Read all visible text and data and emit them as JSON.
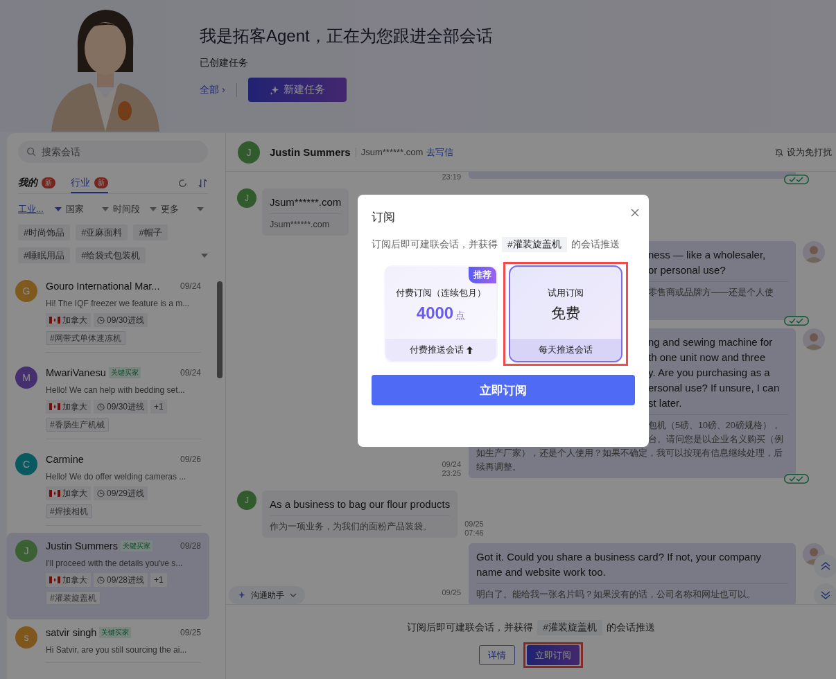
{
  "header": {
    "title": "我是拓客Agent，正在为您跟进全部会话",
    "subtitle": "已创建任务",
    "all_link": "全部 ›",
    "new_task_button": "新建任务"
  },
  "sidebar": {
    "search": {
      "placeholder": "搜索会话"
    },
    "tabs": [
      {
        "label": "我的",
        "badge": "新",
        "selected": false
      },
      {
        "label": "行业",
        "badge": "新",
        "selected": true
      }
    ],
    "filters": [
      {
        "label": "工业...",
        "active": true
      },
      {
        "label": "国家",
        "active": false
      },
      {
        "label": "时间段",
        "active": false
      },
      {
        "label": "更多",
        "active": false
      }
    ],
    "tags": [
      "#时尚饰品",
      "#亚麻面料",
      "#帽子",
      "#睡眠用品",
      "#给袋式包装机"
    ],
    "conversations": [
      {
        "initial": "G",
        "color": "#7f5a1e",
        "name": "Gouro International Mar...",
        "date": "09/24",
        "preview": "Hi! The IQF freezer we feature is a m...",
        "country": "加拿大",
        "followup": "09/30进线",
        "topic": "#网带式单体速冻机",
        "selected": false
      },
      {
        "initial": "M",
        "color": "#46306f",
        "name": "MwariVanesu",
        "badge": "关键买家",
        "date": "09/24",
        "preview": "Hello! We can help with bedding set...",
        "country": "加拿大",
        "followup": "09/30进线",
        "extra": "+1",
        "topic": "#香肠生产机械",
        "selected": false
      },
      {
        "initial": "C",
        "color": "#0a5a60",
        "name": "Carmine",
        "date": "09/26",
        "preview": "Hello! We do offer welding cameras ...",
        "country": "加拿大",
        "followup": "09/29进线",
        "topic": "#焊接相机",
        "selected": false
      },
      {
        "initial": "J",
        "color": "#3b6134",
        "name": "Justin Summers",
        "badge": "关键买家",
        "date": "09/28",
        "preview": "I'll proceed with the details you've s...",
        "country": "加拿大",
        "followup": "09/28进线",
        "extra": "+1",
        "topic": "#灌装旋盖机",
        "selected": true
      },
      {
        "initial": "s",
        "color": "#7f571d",
        "name": "satvir singh",
        "badge": "关键买家",
        "date": "09/25",
        "preview": "Hi Satvir, are you still sourcing the ai...",
        "selected": false
      }
    ]
  },
  "chat": {
    "contact": {
      "initial": "J",
      "name": "Justin Summers",
      "email": "Jsum******.com",
      "write_link": "去写信"
    },
    "mute_button": "设为免打扰",
    "messages": [
      {
        "kind": "stub",
        "time": [
          "23:19"
        ],
        "read": true
      },
      {
        "kind": "incoming",
        "initial": "J",
        "lines": [
          "Jsum******.com"
        ],
        "translation": [
          "Jsum******.com"
        ]
      },
      {
        "kind": "outgoing",
        "read": true,
        "cut_lines": [
          "ness — like a wholesaler,",
          "or personal use?"
        ],
        "cut_translation": [
          "零售商或品牌方——还是个人使"
        ]
      },
      {
        "kind": "outgoing",
        "read": true,
        "time": [
          "09/24",
          "23:25"
        ],
        "cut_lines": [
          "ng and sewing machine for",
          "th one unit now and three",
          "y. Are you purchasing as a",
          "ersonal use? If unsure, I can",
          "st later."
        ],
        "cut_translation": [
          "包机（5磅、10磅、20磅规格），",
          "台。请问您是以企业名义购买（例"
        ],
        "translation": [
          "如生产厂家），还是个人使用？如果不确定，我可以按现有信息继续处理，后",
          "续再调整。"
        ]
      },
      {
        "kind": "incoming",
        "initial": "J",
        "time": [
          "09/25",
          "07:46"
        ],
        "lines": [
          "As a business to bag our flour products"
        ],
        "translation": [
          "作为一项业务，为我们的面粉产品装袋。"
        ]
      },
      {
        "kind": "outgoing",
        "time": [
          "09/25"
        ],
        "lines": [
          "Got it. Could you share a business card? If not, your company",
          "name and website work too."
        ],
        "translation": [
          "明白了。能给我一张名片吗？如果没有的话，公司名称和网址也可以。"
        ]
      }
    ],
    "assistant_button": "沟通助手",
    "subscribe_bar": {
      "before": "订阅后即可建联会话，并获得",
      "topic": "#灌装旋盖机",
      "after": "的会话推送",
      "details_button": "详情",
      "subscribe_button": "立即订阅",
      "highlighted": true
    }
  },
  "modal": {
    "title": "订阅",
    "before": "订阅后即可建联会话，并获得",
    "topic": "#灌装旋盖机",
    "after": "的会话推送",
    "plans": [
      {
        "kind": "paid",
        "name": "付费订阅（连续包月）",
        "price": "4000",
        "unit": "点",
        "footer": "付费推送会话",
        "badge": "推荐",
        "selected": false,
        "highlighted": false
      },
      {
        "kind": "trial",
        "name": "试用订阅",
        "price": "免费",
        "footer": "每天推送会话",
        "selected": true,
        "highlighted": true
      }
    ],
    "subscribe_button": "立即订阅"
  }
}
